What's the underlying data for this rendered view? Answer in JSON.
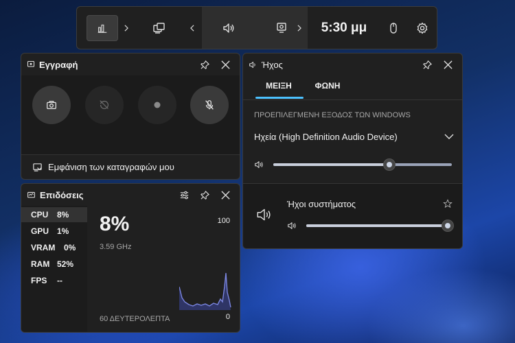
{
  "topbar": {
    "time": "5:30 μμ"
  },
  "record": {
    "title": "Εγγραφή",
    "show_captures": "Εμφάνιση των καταγραφών μου"
  },
  "performance": {
    "title": "Επιδόσεις",
    "stats": [
      {
        "label": "CPU",
        "value": "8%"
      },
      {
        "label": "GPU",
        "value": "1%"
      },
      {
        "label": "VRAM",
        "value": "0%"
      },
      {
        "label": "RAM",
        "value": "52%"
      },
      {
        "label": "FPS",
        "value": "--"
      }
    ],
    "big_value": "8%",
    "frequency": "3.59 GHz",
    "axis_max": "100",
    "axis_min": "0",
    "time_window": "60 ΔΕΥΤΕΡΟΛΕΠΤΑ",
    "graph_color": "#7b86e0"
  },
  "audio": {
    "title": "Ήχος",
    "tabs": [
      "ΜΕΙΞΗ",
      "ΦΩΝΗ"
    ],
    "section_label": "ΠΡΟΕΠΙΛΕΓΜΕΝΗ ΕΞΟΔΟΣ ΤΩΝ WINDOWS",
    "device": "Ηχεία (High Definition Audio Device)",
    "master_volume": 0.65,
    "system_sounds_label": "Ήχοι συστήματος",
    "system_volume": 1.0,
    "accent_color": "#4cc2ff"
  }
}
